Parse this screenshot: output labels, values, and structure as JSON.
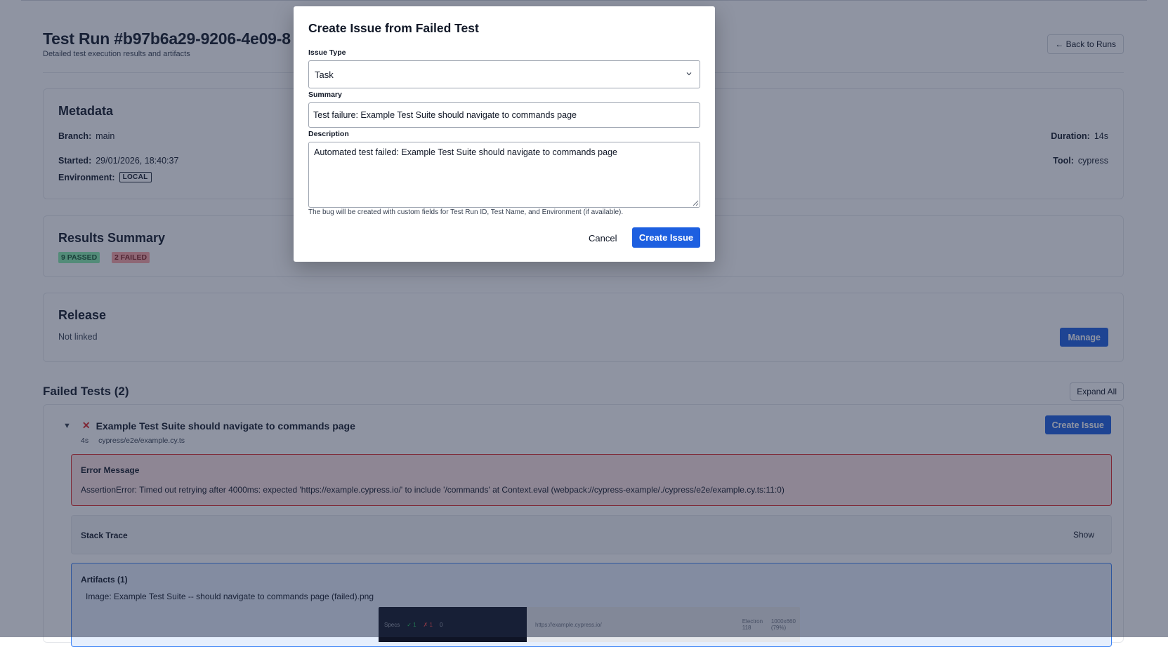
{
  "page": {
    "title": "Test Run #b97b6a29-9206-4e09-8",
    "subtitle": "Detailed test execution results and artifacts",
    "back_button": "← Back to Runs"
  },
  "metadata": {
    "heading": "Metadata",
    "branch_label": "Branch:",
    "branch_value": "main",
    "started_label": "Started:",
    "started_value": "29/01/2026, 18:40:37",
    "environment_label": "Environment:",
    "environment_value": "LOCAL",
    "duration_label": "Duration:",
    "duration_value": "14s",
    "tool_label": "Tool:",
    "tool_value": "cypress"
  },
  "results_summary": {
    "heading": "Results Summary",
    "passed_badge": "9 PASSED",
    "failed_badge": "2 FAILED"
  },
  "release": {
    "heading": "Release",
    "status": "Not linked",
    "manage_button": "Manage"
  },
  "failed_tests": {
    "heading": "Failed Tests (2)",
    "expand_all_button": "Expand All",
    "items": [
      {
        "name": "Example Test Suite should navigate to commands page",
        "duration": "4s",
        "file": "cypress/e2e/example.cy.ts",
        "create_issue_button": "Create Issue",
        "error_title": "Error Message",
        "error_message": "AssertionError: Timed out retrying after 4000ms: expected 'https://example.cypress.io/' to include '/commands' at Context.eval (webpack://cypress-example/./cypress/e2e/example.cy.ts:11:0)",
        "stack_trace_title": "Stack Trace",
        "stack_trace_toggle": "Show",
        "artifacts_title": "Artifacts (1)",
        "artifact_name": "Image: Example Test Suite -- should navigate to commands page (failed).png",
        "screenshot": {
          "specs_label": "Specs",
          "pass_count": "✓ 1",
          "fail_count": "✗ 1",
          "pending_count": "0",
          "url": "https://example.cypress.io/",
          "browser": "Electron 118",
          "viewport": "1000x660 (79%)"
        }
      }
    ]
  },
  "modal": {
    "title": "Create Issue from Failed Test",
    "issue_type_label": "Issue Type",
    "issue_type_value": "Task",
    "summary_label": "Summary",
    "summary_value": "Test failure: Example Test Suite should navigate to commands page",
    "description_label": "Description",
    "description_value": "Automated test failed: Example Test Suite should navigate to commands page",
    "hint": "The bug will be created with custom fields for Test Run ID, Test Name, and Environment (if available).",
    "cancel_button": "Cancel",
    "create_button": "Create Issue"
  },
  "colors": {
    "primary": "#1d5fe0",
    "pass_badge": "#86efac",
    "fail_badge": "#fca5a5",
    "error_border": "#dc2626",
    "artifact_border": "#3b82f6",
    "overlay": "rgba(31,41,70,0.5)"
  },
  "icons": {
    "back": "arrow-left-icon",
    "collapse": "triangle-down-icon",
    "failed": "x-icon",
    "select": "chevron-down-icon",
    "resize": "resize-handle-icon"
  }
}
